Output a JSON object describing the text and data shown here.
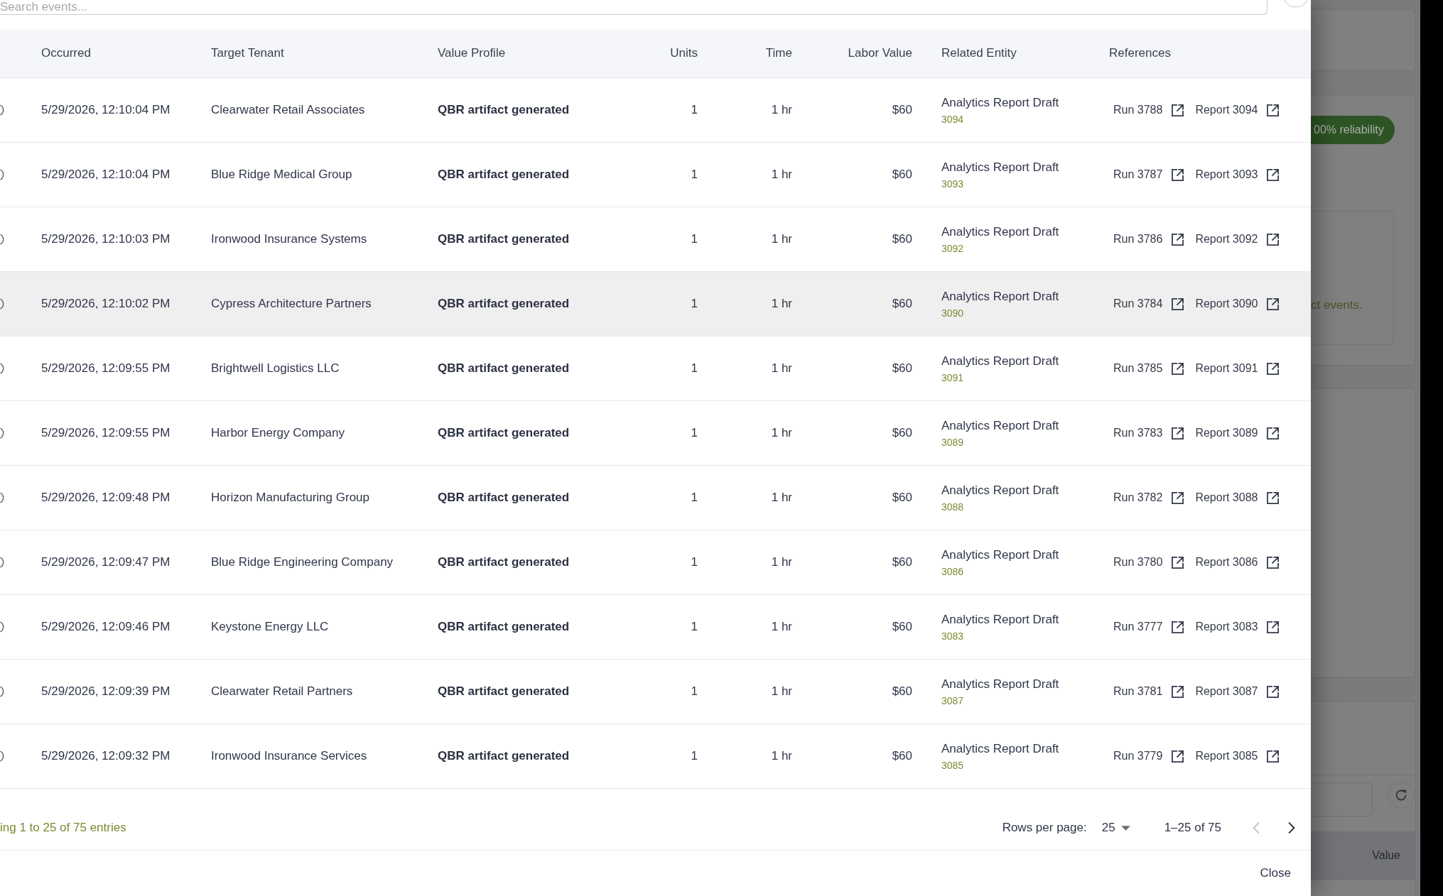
{
  "search": {
    "placeholder": "Search events..."
  },
  "table": {
    "columns": [
      "Occurred",
      "Target Tenant",
      "Value Profile",
      "Units",
      "Time",
      "Labor Value",
      "Related Entity",
      "References"
    ],
    "rows": [
      {
        "occurred": "5/29/2026, 12:10:04 PM",
        "target_tenant": "Clearwater Retail Associates",
        "value_profile": "QBR artifact generated",
        "units": "1",
        "time": "1 hr",
        "labor_value": "$60",
        "related_entity": {
          "name": "Analytics Report Draft",
          "id": "3094"
        },
        "references": [
          {
            "label": "Run 3788"
          },
          {
            "label": "Report 3094"
          }
        ],
        "highlighted": false
      },
      {
        "occurred": "5/29/2026, 12:10:04 PM",
        "target_tenant": "Blue Ridge Medical Group",
        "value_profile": "QBR artifact generated",
        "units": "1",
        "time": "1 hr",
        "labor_value": "$60",
        "related_entity": {
          "name": "Analytics Report Draft",
          "id": "3093"
        },
        "references": [
          {
            "label": "Run 3787"
          },
          {
            "label": "Report 3093"
          }
        ],
        "highlighted": false
      },
      {
        "occurred": "5/29/2026, 12:10:03 PM",
        "target_tenant": "Ironwood Insurance Systems",
        "value_profile": "QBR artifact generated",
        "units": "1",
        "time": "1 hr",
        "labor_value": "$60",
        "related_entity": {
          "name": "Analytics Report Draft",
          "id": "3092"
        },
        "references": [
          {
            "label": "Run 3786"
          },
          {
            "label": "Report 3092"
          }
        ],
        "highlighted": false
      },
      {
        "occurred": "5/29/2026, 12:10:02 PM",
        "target_tenant": "Cypress Architecture Partners",
        "value_profile": "QBR artifact generated",
        "units": "1",
        "time": "1 hr",
        "labor_value": "$60",
        "related_entity": {
          "name": "Analytics Report Draft",
          "id": "3090"
        },
        "references": [
          {
            "label": "Run 3784"
          },
          {
            "label": "Report 3090"
          }
        ],
        "highlighted": true
      },
      {
        "occurred": "5/29/2026, 12:09:55 PM",
        "target_tenant": "Brightwell Logistics LLC",
        "value_profile": "QBR artifact generated",
        "units": "1",
        "time": "1 hr",
        "labor_value": "$60",
        "related_entity": {
          "name": "Analytics Report Draft",
          "id": "3091"
        },
        "references": [
          {
            "label": "Run 3785"
          },
          {
            "label": "Report 3091"
          }
        ],
        "highlighted": false
      },
      {
        "occurred": "5/29/2026, 12:09:55 PM",
        "target_tenant": "Harbor Energy Company",
        "value_profile": "QBR artifact generated",
        "units": "1",
        "time": "1 hr",
        "labor_value": "$60",
        "related_entity": {
          "name": "Analytics Report Draft",
          "id": "3089"
        },
        "references": [
          {
            "label": "Run 3783"
          },
          {
            "label": "Report 3089"
          }
        ],
        "highlighted": false
      },
      {
        "occurred": "5/29/2026, 12:09:48 PM",
        "target_tenant": "Horizon Manufacturing Group",
        "value_profile": "QBR artifact generated",
        "units": "1",
        "time": "1 hr",
        "labor_value": "$60",
        "related_entity": {
          "name": "Analytics Report Draft",
          "id": "3088"
        },
        "references": [
          {
            "label": "Run 3782"
          },
          {
            "label": "Report 3088"
          }
        ],
        "highlighted": false
      },
      {
        "occurred": "5/29/2026, 12:09:47 PM",
        "target_tenant": "Blue Ridge Engineering Company",
        "value_profile": "QBR artifact generated",
        "units": "1",
        "time": "1 hr",
        "labor_value": "$60",
        "related_entity": {
          "name": "Analytics Report Draft",
          "id": "3086"
        },
        "references": [
          {
            "label": "Run 3780"
          },
          {
            "label": "Report 3086"
          }
        ],
        "highlighted": false
      },
      {
        "occurred": "5/29/2026, 12:09:46 PM",
        "target_tenant": "Keystone Energy LLC",
        "value_profile": "QBR artifact generated",
        "units": "1",
        "time": "1 hr",
        "labor_value": "$60",
        "related_entity": {
          "name": "Analytics Report Draft",
          "id": "3083"
        },
        "references": [
          {
            "label": "Run 3777"
          },
          {
            "label": "Report 3083"
          }
        ],
        "highlighted": false
      },
      {
        "occurred": "5/29/2026, 12:09:39 PM",
        "target_tenant": "Clearwater Retail Partners",
        "value_profile": "QBR artifact generated",
        "units": "1",
        "time": "1 hr",
        "labor_value": "$60",
        "related_entity": {
          "name": "Analytics Report Draft",
          "id": "3087"
        },
        "references": [
          {
            "label": "Run 3781"
          },
          {
            "label": "Report 3087"
          }
        ],
        "highlighted": false
      },
      {
        "occurred": "5/29/2026, 12:09:32 PM",
        "target_tenant": "Ironwood Insurance Services",
        "value_profile": "QBR artifact generated",
        "units": "1",
        "time": "1 hr",
        "labor_value": "$60",
        "related_entity": {
          "name": "Analytics Report Draft",
          "id": "3085"
        },
        "references": [
          {
            "label": "Run 3779"
          },
          {
            "label": "Report 3085"
          }
        ],
        "highlighted": false
      }
    ]
  },
  "pagination": {
    "summary": "ing 1 to 25 of 75 entries",
    "rows_per_page_label": "Rows per page:",
    "rows_per_page": "25",
    "range": "1–25 of 75",
    "previous": {
      "disabled": true
    },
    "next": {
      "disabled": false
    }
  },
  "actions": [
    {
      "label": "Close"
    }
  ],
  "background": {
    "badge": "00% reliability",
    "note": "ct events.",
    "column": "Value"
  }
}
